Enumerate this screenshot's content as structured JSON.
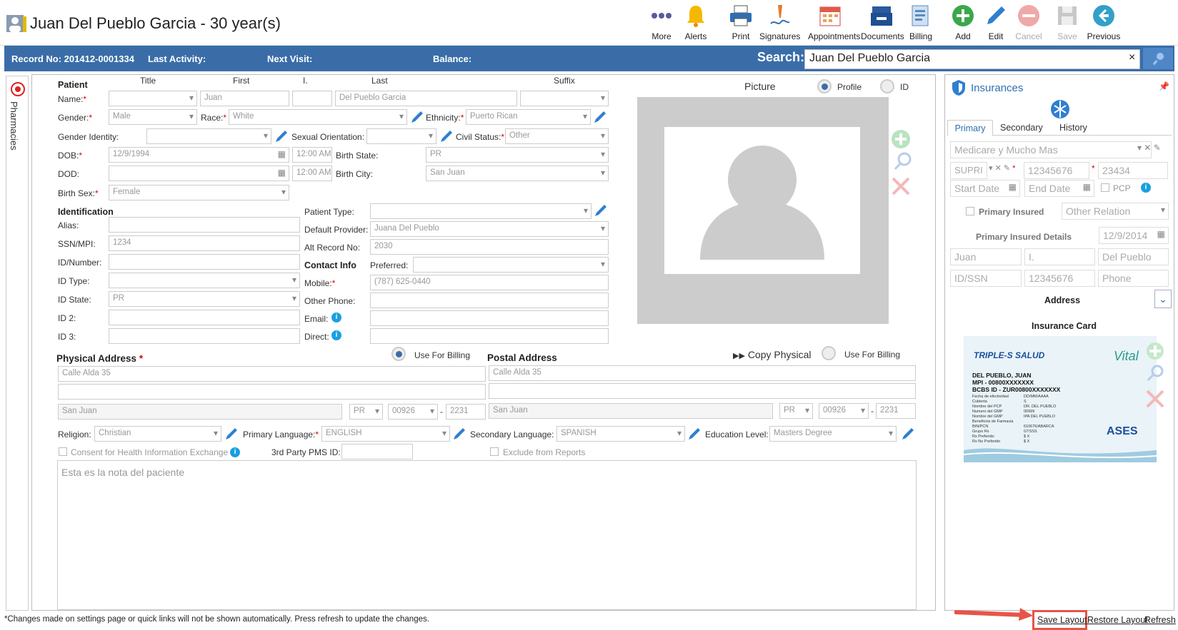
{
  "header": {
    "patient_title": "Juan Del Pueblo Garcia - 30 year(s)",
    "toolbar": [
      {
        "label": "More",
        "icon": "more-icon",
        "disabled": false
      },
      {
        "label": "Alerts",
        "icon": "bell-icon",
        "disabled": false
      },
      {
        "label": "Print",
        "icon": "printer-icon",
        "disabled": false
      },
      {
        "label": "Signatures",
        "icon": "signature-icon",
        "disabled": false
      },
      {
        "label": "Appointments",
        "icon": "calendar-icon",
        "disabled": false
      },
      {
        "label": "Documents",
        "icon": "documents-icon",
        "disabled": false
      },
      {
        "label": "Billing",
        "icon": "billing-icon",
        "disabled": false
      },
      {
        "label": "Add",
        "icon": "add-icon",
        "disabled": false
      },
      {
        "label": "Edit",
        "icon": "edit-icon",
        "disabled": false
      },
      {
        "label": "Cancel",
        "icon": "cancel-icon",
        "disabled": true
      },
      {
        "label": "Save",
        "icon": "save-icon",
        "disabled": true
      },
      {
        "label": "Previous",
        "icon": "previous-icon",
        "disabled": false
      }
    ]
  },
  "bar": {
    "record_no": "Record No: 201412-0001334",
    "last_activity": "Last Activity:",
    "next_visit": "Next Visit:",
    "balance": "Balance:",
    "search_label": "Search:",
    "search_value": "Juan Del Pueblo Garcia",
    "clear": "×"
  },
  "side": {
    "label": "Pharmacies"
  },
  "patient": {
    "section": "Patient",
    "col_title": "Title",
    "col_first": "First",
    "col_i": "I.",
    "col_last": "Last",
    "col_suffix": "Suffix",
    "name_label": "Name:",
    "first": "Juan",
    "last": "Del Pueblo Garcia",
    "gender_label": "Gender:",
    "gender": "Male",
    "race_label": "Race:",
    "race": "White",
    "ethnicity_label": "Ethnicity:",
    "ethnicity": "Puerto Rican",
    "gender_identity_label": "Gender Identity:",
    "sexual_orientation_label": "Sexual Orientation:",
    "civil_status_label": "Civil Status:",
    "civil_status": "Other",
    "dob_label": "DOB:",
    "dob": "12/9/1994",
    "dob_time": "12:00 AM",
    "birth_state_label": "Birth State:",
    "birth_state": "PR",
    "dod_label": "DOD:",
    "dod_time": "12:00 AM",
    "birth_city_label": "Birth City:",
    "birth_city": "San Juan",
    "birth_sex_label": "Birth Sex:",
    "birth_sex": "Female"
  },
  "identification": {
    "section": "Identification",
    "alias_label": "Alias:",
    "ssn_label": "SSN/MPI:",
    "ssn": "1234",
    "idnumber_label": "ID/Number:",
    "idtype_label": "ID Type:",
    "idstate_label": "ID State:",
    "idstate": "PR",
    "id2_label": "ID 2:",
    "id3_label": "ID 3:",
    "patient_type_label": "Patient Type:",
    "default_provider_label": "Default Provider:",
    "default_provider": "Juana Del Pueblo",
    "alt_record_label": "Alt Record No:",
    "alt_record": "2030",
    "contact_section": "Contact Info",
    "preferred_label": "Preferred:",
    "mobile_label": "Mobile:",
    "mobile": "(787) 625-0440",
    "other_phone_label": "Other Phone:",
    "email_label": "Email:",
    "direct_label": "Direct:"
  },
  "picture": {
    "label": "Picture",
    "profile": "Profile",
    "id": "ID"
  },
  "physical": {
    "section": "Physical Address",
    "use_billing": "Use For Billing",
    "line1": "Calle Alda 35",
    "city": "San Juan",
    "state": "PR",
    "zip": "00926",
    "zip4": "2231"
  },
  "postal": {
    "section": "Postal Address",
    "copy": "Copy Physical",
    "use_billing": "Use For Billing",
    "line1": "Calle Alda 35",
    "city": "San Juan",
    "state": "PR",
    "zip": "00926",
    "zip4": "2231"
  },
  "misc": {
    "religion_label": "Religion:",
    "religion": "Christian",
    "primary_lang_label": "Primary Language:",
    "primary_lang": "ENGLISH",
    "secondary_lang_label": "Secondary Language:",
    "secondary_lang": "SPANISH",
    "education_label": "Education Level:",
    "education": "Masters Degree",
    "consent_label": "Consent for Health Information Exchange",
    "pms_label": "3rd Party PMS ID:",
    "exclude_label": "Exclude from Reports",
    "notes": "Esta es la nota del paciente"
  },
  "insurance": {
    "title": "Insurances",
    "tabs": [
      "Primary",
      "Secondary",
      "History"
    ],
    "plan": "Medicare y Mucho Mas",
    "code": "SUPRI",
    "member_id": "12345676",
    "group": "23434",
    "start_date": "Start Date",
    "end_date": "End Date",
    "pcp": "PCP",
    "primary_insured": "Primary Insured",
    "other_relation": "Other Relation",
    "insured_details": "Primary Insured Details",
    "insured_dob": "12/9/2014",
    "insured_first": "Juan",
    "insured_i": "I.",
    "insured_last": "Del Pueblo",
    "insured_idssn": "ID/SSN",
    "insured_id": "12345676",
    "insured_phone": "Phone",
    "address": "Address",
    "card_label": "Insurance Card",
    "card": {
      "brand": "TRIPLE-S SALUD",
      "name": "DEL PUEBLO, JUAN",
      "mpi": "MPI - 00800XXXXXXX",
      "bcbs": "BCBS ID - ZUR00800XXXXXXX",
      "rows": [
        "Fecha de efectividad",
        "Cubierta",
        "Nombre del PCP",
        "Numero del GMP",
        "Nombre del GMP",
        "Beneficios de Farmacia",
        "BIN/PCN",
        "Grupo Rx",
        "Rx Preferido",
        "Rx No Preferido"
      ],
      "values": [
        "DD/MM/AAAA",
        "S",
        "DR. DEL PUEBLO",
        "00999",
        "IPA DEL PUEBLO",
        "",
        "610676/ABARCA",
        "GTSSS",
        "$ X",
        "$ X"
      ],
      "vital": "Vital",
      "ases": "ASES"
    }
  },
  "footer": {
    "note": "*Changes made on settings page or quick links will not be shown automatically. Press refresh to update the changes.",
    "save_layout": "Save Layout",
    "restore_layout": "Restore Layout",
    "refresh": "Refresh"
  }
}
